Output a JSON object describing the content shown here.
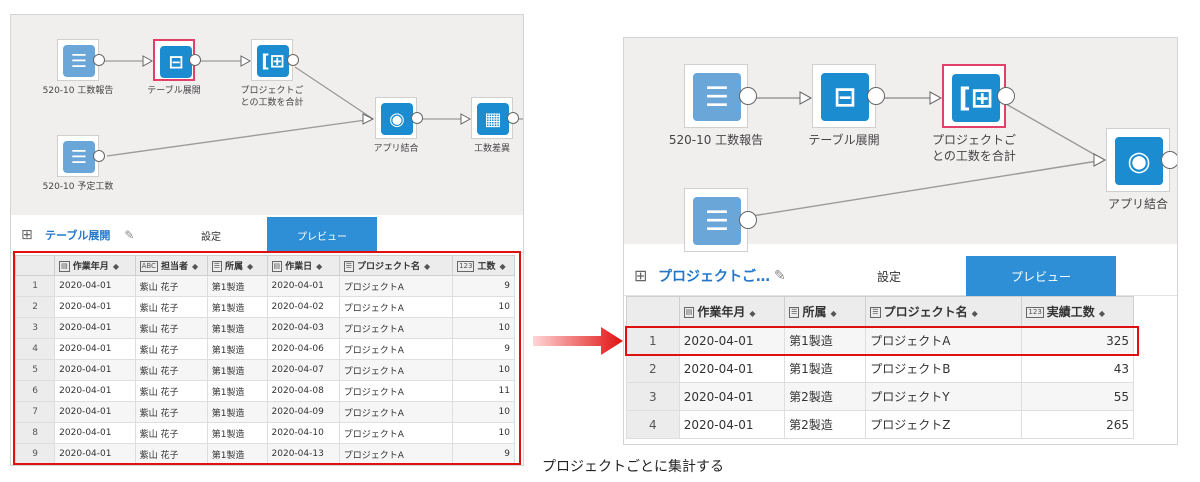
{
  "colors": {
    "accent": "#2f8fd6",
    "node": "#1b8cd0",
    "highlight": "#e01010",
    "canvas": "#f1eeee"
  },
  "left": {
    "nodes": [
      {
        "id": "n1",
        "label": "520-10 工数報告",
        "icon": "table-list-icon"
      },
      {
        "id": "n2",
        "label": "テーブル展開",
        "icon": "table-expand-icon"
      },
      {
        "id": "n3",
        "label": "プロジェクトご\nとの工数を合計",
        "icon": "aggregate-icon"
      },
      {
        "id": "n4",
        "label": "アプリ結合",
        "icon": "join-icon"
      },
      {
        "id": "n5",
        "label": "工数差異",
        "icon": "calc-table-icon"
      },
      {
        "id": "n6",
        "label": "520-10 予定工数",
        "icon": "table-list-icon"
      }
    ],
    "toolbar": {
      "title": "テーブル展開",
      "tab_settings": "設定",
      "tab_preview": "プレビュー"
    },
    "table": {
      "columns": [
        {
          "label": "作業年月",
          "icon": "date-icon"
        },
        {
          "label": "担当者",
          "icon": "text-icon",
          "icon_text": "ABC"
        },
        {
          "label": "所属",
          "icon": "dropdown-icon"
        },
        {
          "label": "作業日",
          "icon": "date-icon"
        },
        {
          "label": "プロジェクト名",
          "icon": "dropdown-icon"
        },
        {
          "label": "工数",
          "icon": "number-icon",
          "icon_text": "123"
        }
      ],
      "rows": [
        [
          "1",
          "2020-04-01",
          "紫山 花子",
          "第1製造",
          "2020-04-01",
          "プロジェクトA",
          "9"
        ],
        [
          "2",
          "2020-04-01",
          "紫山 花子",
          "第1製造",
          "2020-04-02",
          "プロジェクトA",
          "10"
        ],
        [
          "3",
          "2020-04-01",
          "紫山 花子",
          "第1製造",
          "2020-04-03",
          "プロジェクトA",
          "10"
        ],
        [
          "4",
          "2020-04-01",
          "紫山 花子",
          "第1製造",
          "2020-04-06",
          "プロジェクトA",
          "9"
        ],
        [
          "5",
          "2020-04-01",
          "紫山 花子",
          "第1製造",
          "2020-04-07",
          "プロジェクトA",
          "10"
        ],
        [
          "6",
          "2020-04-01",
          "紫山 花子",
          "第1製造",
          "2020-04-08",
          "プロジェクトA",
          "11"
        ],
        [
          "7",
          "2020-04-01",
          "紫山 花子",
          "第1製造",
          "2020-04-09",
          "プロジェクトA",
          "10"
        ],
        [
          "8",
          "2020-04-01",
          "紫山 花子",
          "第1製造",
          "2020-04-10",
          "プロジェクトA",
          "10"
        ],
        [
          "9",
          "2020-04-01",
          "紫山 花子",
          "第1製造",
          "2020-04-13",
          "プロジェクトA",
          "9"
        ]
      ]
    }
  },
  "right": {
    "nodes": [
      {
        "id": "r1",
        "label": "520-10 工数報告",
        "icon": "table-list-icon"
      },
      {
        "id": "r2",
        "label": "テーブル展開",
        "icon": "table-expand-icon"
      },
      {
        "id": "r3",
        "label": "プロジェクトご\nとの工数を合計",
        "icon": "aggregate-icon"
      },
      {
        "id": "r4",
        "label": "アプリ結合",
        "icon": "join-icon"
      },
      {
        "id": "r5",
        "label": "",
        "icon": "table-list-icon"
      }
    ],
    "toolbar": {
      "title": "プロジェクトご…",
      "tab_settings": "設定",
      "tab_preview": "プレビュー"
    },
    "table": {
      "columns": [
        {
          "label": "作業年月",
          "icon": "date-icon"
        },
        {
          "label": "所属",
          "icon": "dropdown-icon"
        },
        {
          "label": "プロジェクト名",
          "icon": "dropdown-icon"
        },
        {
          "label": "実績工数",
          "icon": "number-icon",
          "icon_text": "123"
        }
      ],
      "rows": [
        [
          "1",
          "2020-04-01",
          "第1製造",
          "プロジェクトA",
          "325"
        ],
        [
          "2",
          "2020-04-01",
          "第1製造",
          "プロジェクトB",
          "43"
        ],
        [
          "3",
          "2020-04-01",
          "第2製造",
          "プロジェクトY",
          "55"
        ],
        [
          "4",
          "2020-04-01",
          "第2製造",
          "プロジェクトZ",
          "265"
        ]
      ]
    }
  },
  "caption": "プロジェクトごとに集計する"
}
